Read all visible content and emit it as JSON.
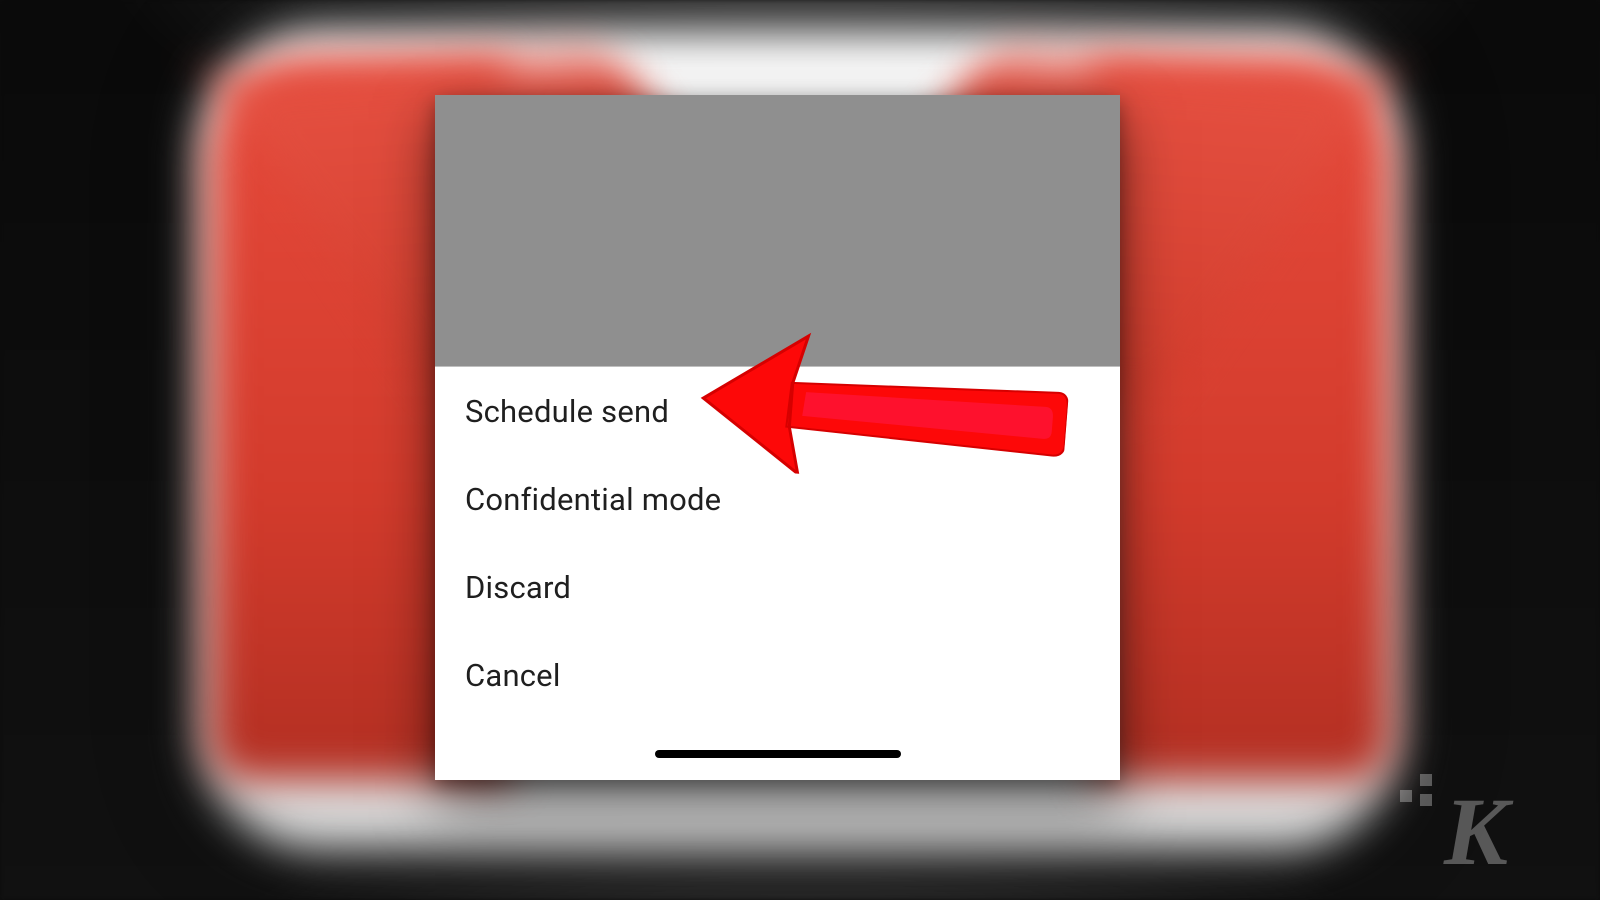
{
  "callout": {
    "color": "#fd0808",
    "highlight": "#ff1a4d"
  },
  "sheet": {
    "items": [
      {
        "label": "Schedule send"
      },
      {
        "label": "Confidential mode"
      },
      {
        "label": "Discard"
      },
      {
        "label": "Cancel"
      }
    ]
  },
  "watermark": {
    "letter": "K"
  }
}
